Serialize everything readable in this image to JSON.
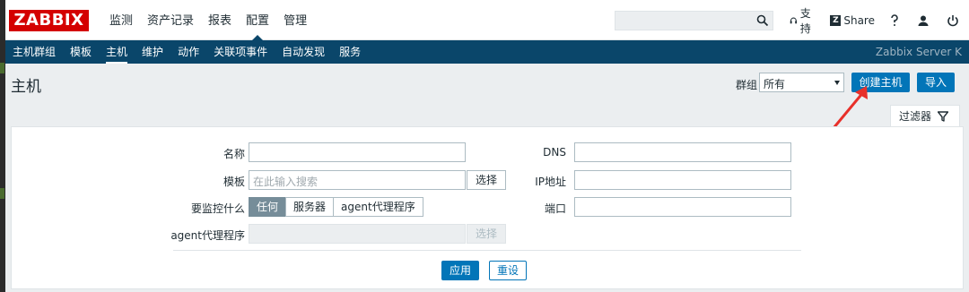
{
  "brand": {
    "logo_text": "ZABBIX",
    "logo_color": "#d40000"
  },
  "main_menu": [
    {
      "label": "监测",
      "active": false
    },
    {
      "label": "资产记录",
      "active": false
    },
    {
      "label": "报表",
      "active": false
    },
    {
      "label": "配置",
      "active": true
    },
    {
      "label": "管理",
      "active": false
    }
  ],
  "search": {
    "value": "",
    "icon": "search-icon"
  },
  "tools": {
    "support_label": "支持",
    "share_label": "Share",
    "share_badge": "Z",
    "help_icon": "help-icon",
    "user_icon": "user-icon",
    "logout_icon": "power-icon"
  },
  "sub_menu": [
    {
      "label": "主机群组",
      "active": false
    },
    {
      "label": "模板",
      "active": false
    },
    {
      "label": "主机",
      "active": true
    },
    {
      "label": "维护",
      "active": false
    },
    {
      "label": "动作",
      "active": false
    },
    {
      "label": "关联项事件",
      "active": false
    },
    {
      "label": "自动发现",
      "active": false
    },
    {
      "label": "服务",
      "active": false
    }
  ],
  "server_name": "Zabbix Server K",
  "page": {
    "title": "主机",
    "group_label": "群组",
    "group_value": "所有",
    "create_button": "创建主机",
    "import_button": "导入"
  },
  "filter": {
    "tab_label": "过滤器",
    "name_label": "名称",
    "name_value": "",
    "template_label": "模板",
    "template_placeholder": "在此输入搜索",
    "select_button": "选择",
    "monitored_label": "要监控什么",
    "monitored_options": [
      "任何",
      "服务器",
      "agent代理程序"
    ],
    "monitored_selected": "任何",
    "proxy_label": "agent代理程序",
    "proxy_select_button": "选择",
    "dns_label": "DNS",
    "dns_value": "",
    "ip_label": "IP地址",
    "ip_value": "",
    "port_label": "端口",
    "port_value": "",
    "apply_button": "应用",
    "reset_button": "重设"
  },
  "colors": {
    "nav_bg": "#0a466a",
    "primary": "#0275b8",
    "selected_segment": "#768d99",
    "annotation": "#e8302a"
  }
}
